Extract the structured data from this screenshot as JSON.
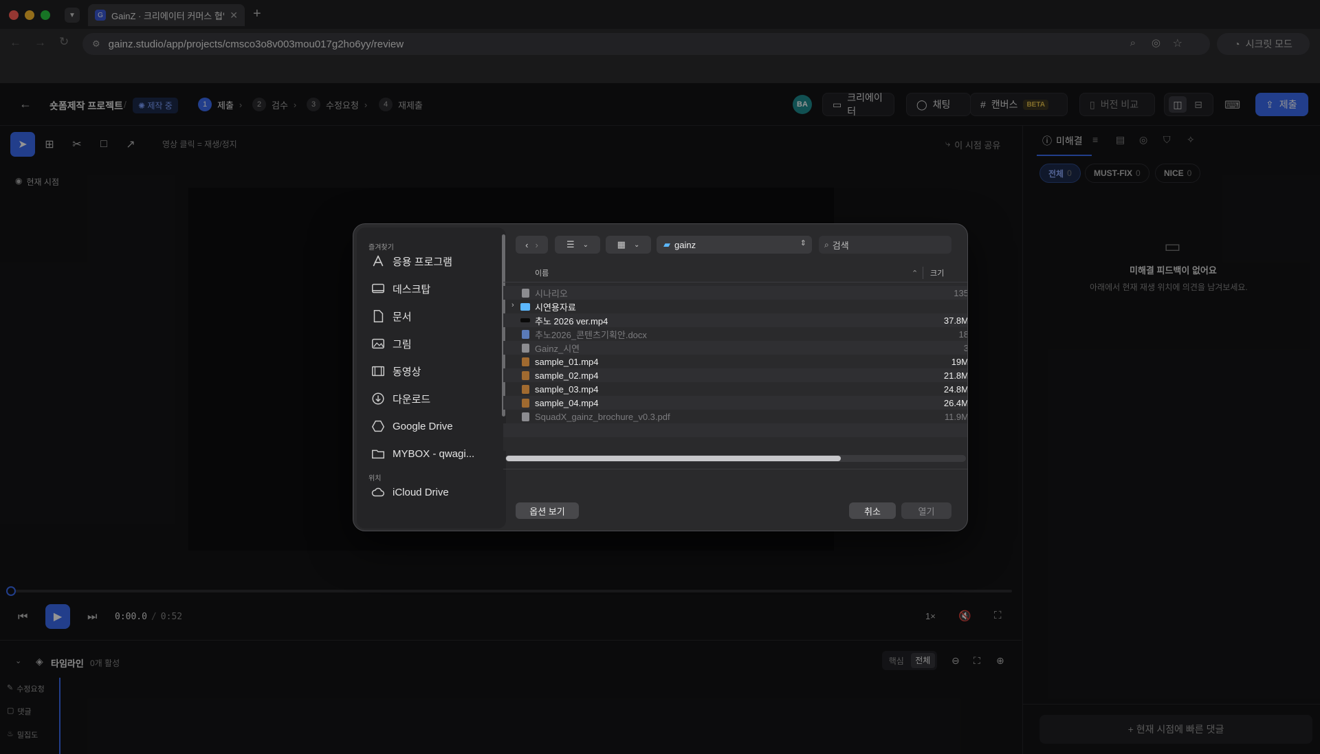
{
  "browser": {
    "tab_title": "GainZ · 크리에이터 커머스 협업 C",
    "tab_favicon": "G",
    "url": "gainz.studio/app/projects/cmsco3o8v003mou017g2ho6yy/review",
    "incognito_label": "시크릿 모드"
  },
  "header": {
    "project": "숏폼제작 프로젝트",
    "separator": "/",
    "status": "제작 중",
    "steps": [
      {
        "num": "1",
        "label": "제출"
      },
      {
        "num": "2",
        "label": "검수"
      },
      {
        "num": "3",
        "label": "수정요청"
      },
      {
        "num": "4",
        "label": "재제출"
      }
    ],
    "avatar": "BA",
    "creator_btn": "크리에이터",
    "chat_btn": "채팅",
    "canvas_btn": "캔버스",
    "canvas_badge": "BETA",
    "compare_btn": "버전 비교",
    "submit_btn": "제출"
  },
  "viewer": {
    "hint": "영상 클릭 = 재생/정지",
    "share": "이 시점 공유",
    "current_time_label": "현재 시점",
    "time_current": "0:00.0",
    "time_sep": "/",
    "time_total": "0:52",
    "speed": "1×",
    "progress": 0
  },
  "timeline": {
    "title": "타임라인",
    "active": "0개 활성",
    "core": "핵심",
    "all": "전체",
    "tracks": [
      "수정요청",
      "댓글",
      "밀집도"
    ]
  },
  "right_panel": {
    "tab": "미해결",
    "chips": [
      {
        "label": "전체",
        "count": "0"
      },
      {
        "label": "MUST-FIX",
        "count": "0"
      },
      {
        "label": "NICE",
        "count": "0"
      }
    ],
    "empty_title": "미해결 피드백이 없어요",
    "empty_desc": "아래에서 현재 재생 위치에 의견을 남겨보세요.",
    "quick_comment": "+ 현재 시점에 빠른 댓글"
  },
  "dialog": {
    "favorites_label": "즐겨찾기",
    "locations_label": "위치",
    "sidebar": [
      {
        "label": "응용 프로그램",
        "icon": "applications-icon"
      },
      {
        "label": "데스크탑",
        "icon": "desktop-icon"
      },
      {
        "label": "문서",
        "icon": "document-icon"
      },
      {
        "label": "그림",
        "icon": "pictures-icon"
      },
      {
        "label": "동영상",
        "icon": "movies-icon"
      },
      {
        "label": "다운로드",
        "icon": "download-icon"
      },
      {
        "label": "Google Drive",
        "icon": "google-drive-icon"
      },
      {
        "label": "MYBOX - qwagi...",
        "icon": "folder-icon"
      }
    ],
    "icloud": "iCloud Drive",
    "location": "gainz",
    "search_placeholder": "검색",
    "col_name": "이름",
    "col_size": "크기",
    "files": [
      {
        "name": "시나리오",
        "size": "135",
        "dim": true,
        "kind": "doc"
      },
      {
        "name": "시연용자료",
        "size": "",
        "dim": false,
        "kind": "folder"
      },
      {
        "name": "추노 2026 ver.mp4",
        "size": "37.8M",
        "dim": false,
        "kind": "video-black"
      },
      {
        "name": "추노2026_콘텐츠기획안.docx",
        "size": "18",
        "dim": true,
        "kind": "docx"
      },
      {
        "name": "Gainz_시연",
        "size": "3",
        "dim": true,
        "kind": "doc"
      },
      {
        "name": "sample_01.mp4",
        "size": "19M",
        "dim": false,
        "kind": "video"
      },
      {
        "name": "sample_02.mp4",
        "size": "21.8M",
        "dim": false,
        "kind": "video"
      },
      {
        "name": "sample_03.mp4",
        "size": "24.8M",
        "dim": false,
        "kind": "video"
      },
      {
        "name": "sample_04.mp4",
        "size": "26.4M",
        "dim": false,
        "kind": "video"
      },
      {
        "name": "SquadX_gainz_brochure_v0.3.pdf",
        "size": "11.9M",
        "dim": true,
        "kind": "pdf"
      }
    ],
    "options_btn": "옵션 보기",
    "cancel_btn": "취소",
    "open_btn": "열기"
  }
}
